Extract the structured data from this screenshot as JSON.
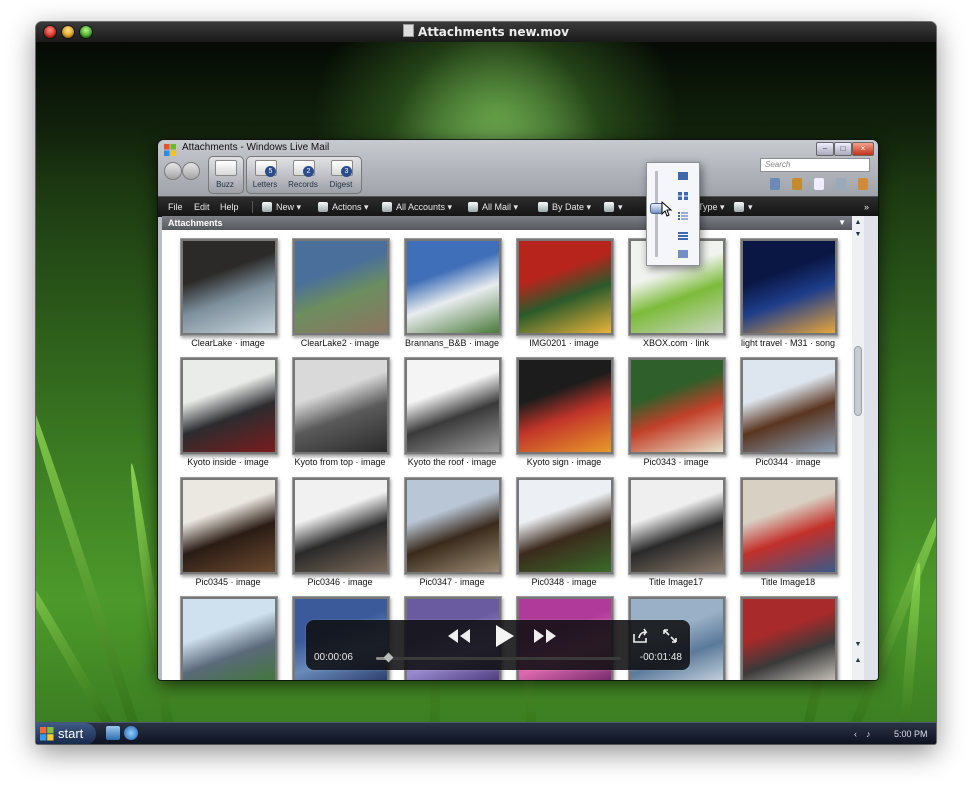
{
  "mac_window": {
    "title": "Attachments new.mov"
  },
  "wlm": {
    "title": "Attachments - Windows Live Mail",
    "search_placeholder": "Search",
    "tiles": [
      {
        "label": "Buzz",
        "badge": ""
      },
      {
        "label": "Letters",
        "badge": "5"
      },
      {
        "label": "Records",
        "badge": "2"
      },
      {
        "label": "Digest",
        "badge": "3"
      }
    ],
    "toolbar": {
      "file": "File",
      "edit": "Edit",
      "help": "Help",
      "new": "New ▾",
      "actions": "Actions ▾",
      "all_accounts": "All Accounts ▾",
      "all_mail": "All Mail ▾",
      "by_date": "By Date ▾",
      "type": "Type ▾",
      "more": "»"
    },
    "section_header": "Attachments",
    "attachments": [
      {
        "caption": "ClearLake · image",
        "colors": [
          "#2c2a28",
          "#7c8f9c",
          "#c9d6de"
        ]
      },
      {
        "caption": "ClearLake2 · image",
        "colors": [
          "#4a6f9b",
          "#6d8e5e",
          "#8c7562"
        ]
      },
      {
        "caption": "Brannans_B&B · image",
        "colors": [
          "#3f6fb8",
          "#e9ecef",
          "#4a7a3a"
        ]
      },
      {
        "caption": "IMG0201 · image",
        "colors": [
          "#b7241c",
          "#2b5a2b",
          "#e9b33a"
        ]
      },
      {
        "caption": "XBOX.com · link",
        "colors": [
          "#f1f3ef",
          "#7dbb3a",
          "#c8d5c0"
        ]
      },
      {
        "caption": "light travel · M31 · song",
        "colors": [
          "#0a1644",
          "#1e3d8a",
          "#e8a63a"
        ]
      },
      {
        "caption": "Kyoto inside · image",
        "colors": [
          "#e9ece9",
          "#2c2c30",
          "#7a1c1c"
        ]
      },
      {
        "caption": "Kyoto from top · image",
        "colors": [
          "#d9d9d9",
          "#5a5a5a",
          "#2b2b2b"
        ]
      },
      {
        "caption": "Kyoto the roof · image",
        "colors": [
          "#f4f4f4",
          "#3a3a3a",
          "#9a9a9a"
        ]
      },
      {
        "caption": "Kyoto sign · image",
        "colors": [
          "#1c1c1c",
          "#c2352a",
          "#e89a2a"
        ]
      },
      {
        "caption": "Pic0343 · image",
        "colors": [
          "#2f5f2a",
          "#c2402a",
          "#e9e2c9"
        ]
      },
      {
        "caption": "Pic0344 · image",
        "colors": [
          "#dde6ef",
          "#5a3520",
          "#8aa0b8"
        ]
      },
      {
        "caption": "Pic0345 · image",
        "colors": [
          "#ebe8e1",
          "#2a1c14",
          "#6a4a30"
        ]
      },
      {
        "caption": "Pic0346 · image",
        "colors": [
          "#f1f1f1",
          "#2a2a2a",
          "#7a6a5a"
        ]
      },
      {
        "caption": "Pic0347 · image",
        "colors": [
          "#b9c6d6",
          "#3a2a1c",
          "#9a8a72"
        ]
      },
      {
        "caption": "Pic0348 · image",
        "colors": [
          "#eceff3",
          "#3b2a1c",
          "#3a6a2a"
        ]
      },
      {
        "caption": "Title Image17",
        "colors": [
          "#efefef",
          "#2a2a2a",
          "#8a7a6a"
        ]
      },
      {
        "caption": "Title Image18",
        "colors": [
          "#d9d0c4",
          "#c2302a",
          "#3a5a8a"
        ]
      },
      {
        "caption": "",
        "colors": [
          "#cfe0ee",
          "#5a6a7a",
          "#3b7a2a"
        ]
      },
      {
        "caption": "",
        "colors": [
          "#3a5a9a",
          "#6a8aba",
          "#1c2c5a"
        ]
      },
      {
        "caption": "",
        "colors": [
          "#6a5aa0",
          "#9a8ad0",
          "#3a2a6a"
        ]
      },
      {
        "caption": "",
        "colors": [
          "#b03a9a",
          "#e06ab0",
          "#5a1a5a"
        ]
      },
      {
        "caption": "",
        "colors": [
          "#9ab0c6",
          "#5a7a9a",
          "#dfe6ee"
        ]
      },
      {
        "caption": "",
        "colors": [
          "#a82a2a",
          "#3a3a3a",
          "#e9e2d8"
        ]
      }
    ]
  },
  "player": {
    "elapsed": "00:00:06",
    "remaining": "-00:01:48",
    "progress": 0.05
  },
  "taskbar": {
    "start_label": "start",
    "clock": "5:00 PM"
  }
}
